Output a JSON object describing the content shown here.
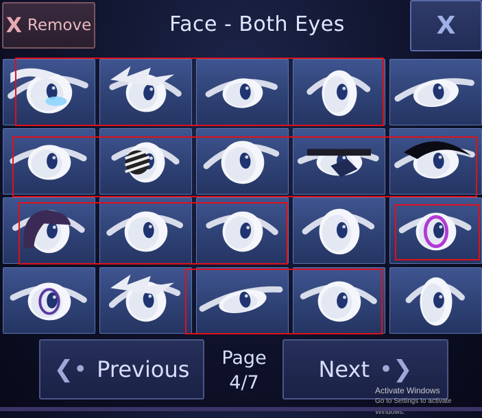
{
  "header": {
    "remove_icon": "X",
    "remove_label": "Remove",
    "title": "Face - Both Eyes",
    "close_icon": "X"
  },
  "pagination": {
    "prev_label": "Previous",
    "next_label": "Next",
    "page_label": "Page",
    "page_value": "4/7"
  },
  "watermark": {
    "line1": "Activate Windows",
    "line2": "Go to Settings to activate Windows."
  },
  "eye_tiles": [
    {
      "id": "eye-1",
      "style": "side-bangs-blue-tear"
    },
    {
      "id": "eye-2",
      "style": "spiky-side"
    },
    {
      "id": "eye-3",
      "style": "narrow-lidded"
    },
    {
      "id": "eye-4",
      "style": "round-wide"
    },
    {
      "id": "eye-5",
      "style": "sleepy-half"
    },
    {
      "id": "eye-6",
      "style": "flat-lid"
    },
    {
      "id": "eye-7",
      "style": "bandaged-striped"
    },
    {
      "id": "eye-8",
      "style": "sharp-wing"
    },
    {
      "id": "eye-9",
      "style": "eyepatch-lashes"
    },
    {
      "id": "eye-10",
      "style": "black-winged-lashes"
    },
    {
      "id": "eye-11",
      "style": "dark-hood"
    },
    {
      "id": "eye-12",
      "style": "soft-almond"
    },
    {
      "id": "eye-13",
      "style": "tilted-round"
    },
    {
      "id": "eye-14",
      "style": "big-round"
    },
    {
      "id": "eye-15",
      "style": "purple-ring-sparkle"
    },
    {
      "id": "eye-16",
      "style": "sparkle-low-lid"
    },
    {
      "id": "eye-17",
      "style": "spiky-brow"
    },
    {
      "id": "eye-18",
      "style": "narrow-slit"
    },
    {
      "id": "eye-19",
      "style": "wavy-brow"
    },
    {
      "id": "eye-20",
      "style": "tall-oval"
    }
  ],
  "colors": {
    "tile_bg": "#3a4f88",
    "highlight": "#e0101a",
    "iris": "#1f3470"
  }
}
